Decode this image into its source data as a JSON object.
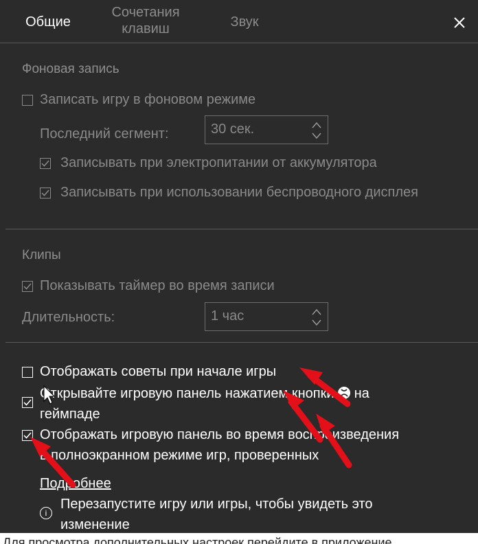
{
  "tabs": [
    {
      "label": "Общие"
    },
    {
      "label": "Сочетания клавиш"
    },
    {
      "label": "Звук"
    }
  ],
  "close_icon": "close-icon",
  "background_recording": {
    "title": "Фоновая запись",
    "record_game_label": "Записать игру в фоновом режиме",
    "last_segment_label": "Последний сегмент:",
    "last_segment_value": "30 сек.",
    "battery_label": "Записывать при электропитании от аккумулятора",
    "wireless_label": "Записывать при использовании беспроводного дисплея"
  },
  "clips": {
    "title": "Клипы",
    "timer_label": "Показывать таймер во время записи",
    "duration_label": "Длительность:",
    "duration_value": "1 час"
  },
  "options": {
    "tips_label": "Отображать советы при начале игры",
    "gamepad_label_a": "Открывайте игровую панель нажатием кнопки",
    "gamepad_label_b": "на",
    "gamepad_label_c": "геймпаде",
    "fullscreen_label_a": "Отображать игровую панель во время воспроизведения",
    "fullscreen_label_b": "в полноэкранном режиме игр, проверенных",
    "more_link": "Подробнее",
    "restart_label_a": "Перезапустите игру или игры, чтобы увидеть это",
    "restart_label_b": "изменение"
  },
  "bottom_note": "Для просмотра дополнительных настроек перейдите в приложение",
  "colors": {
    "background": "#2b2b2b",
    "arrow": "#e3101a",
    "text_dim": "#8a8a8a",
    "text_bright": "#ffffff"
  }
}
